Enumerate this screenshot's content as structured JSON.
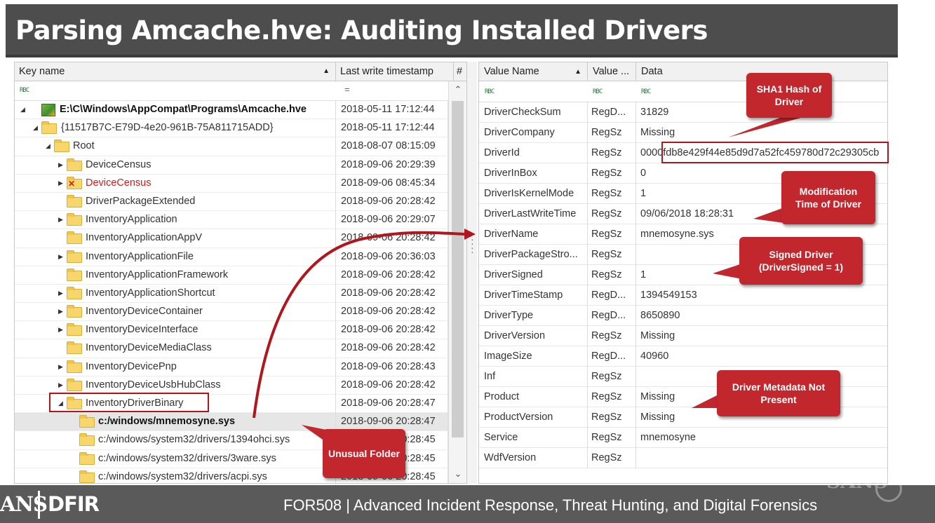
{
  "slide": {
    "title": "Parsing Amcache.hve: Auditing Installed Drivers",
    "footer_brand_left": "ANS",
    "footer_brand_right": "DFIR",
    "footer_course": "FOR508  |  Advanced Incident Response, Threat Hunting, and Digital Forensics",
    "watermark": "SANS"
  },
  "left_pane": {
    "columns": [
      "Key name",
      "Last write timestamp",
      "#"
    ],
    "filter_icon": "RBC",
    "eq_icon": "=",
    "rows": [
      {
        "label": "E:\\C\\Windows\\AppCompat\\Programs\\Amcache.hve",
        "ts": "2018-05-11 17:12:44"
      },
      {
        "label": "{11517B7C-E79D-4e20-961B-75A811715ADD}",
        "ts": "2018-05-11 17:12:44"
      },
      {
        "label": "Root",
        "ts": "2018-08-07 08:15:09"
      },
      {
        "label": "DeviceCensus",
        "ts": "2018-09-06 20:29:39"
      },
      {
        "label": "DeviceCensus",
        "ts": "2018-09-06 08:45:34"
      },
      {
        "label": "DriverPackageExtended",
        "ts": "2018-09-06 20:28:42"
      },
      {
        "label": "InventoryApplication",
        "ts": "2018-09-06 20:29:07"
      },
      {
        "label": "InventoryApplicationAppV",
        "ts": "2018-09-06 20:28:42"
      },
      {
        "label": "InventoryApplicationFile",
        "ts": "2018-09-06 20:36:03"
      },
      {
        "label": "InventoryApplicationFramework",
        "ts": "2018-09-06 20:28:42"
      },
      {
        "label": "InventoryApplicationShortcut",
        "ts": "2018-09-06 20:28:42"
      },
      {
        "label": "InventoryDeviceContainer",
        "ts": "2018-09-06 20:28:42"
      },
      {
        "label": "InventoryDeviceInterface",
        "ts": "2018-09-06 20:28:42"
      },
      {
        "label": "InventoryDeviceMediaClass",
        "ts": "2018-09-06 20:28:42"
      },
      {
        "label": "InventoryDevicePnp",
        "ts": "2018-09-06 20:28:43"
      },
      {
        "label": "InventoryDeviceUsbHubClass",
        "ts": "2018-09-06 20:28:42"
      },
      {
        "label": "InventoryDriverBinary",
        "ts": "2018-09-06 20:28:47"
      },
      {
        "label": "c:/windows/mnemosyne.sys",
        "ts": "2018-09-06 20:28:47"
      },
      {
        "label": "c:/windows/system32/drivers/1394ohci.sys",
        "ts": "2018-09-06 20:28:45"
      },
      {
        "label": "c:/windows/system32/drivers/3ware.sys",
        "ts": "2018-09-06 20:28:45"
      },
      {
        "label": "c:/windows/system32/drivers/acpi.sys",
        "ts": "2018-09-06 20:28:45"
      }
    ]
  },
  "right_pane": {
    "columns": [
      "Value Name",
      "Value ...",
      "Data"
    ],
    "filter_icon": "RBC",
    "rows": [
      {
        "name": "DriverCheckSum",
        "type": "RegD...",
        "data": "31829"
      },
      {
        "name": "DriverCompany",
        "type": "RegSz",
        "data": "Missing"
      },
      {
        "name": "DriverId",
        "type": "RegSz",
        "data": "0000fdb8e429f44e85d9d7a52fc459780d72c29305cb"
      },
      {
        "name": "DriverInBox",
        "type": "RegSz",
        "data": "0"
      },
      {
        "name": "DriverIsKernelMode",
        "type": "RegSz",
        "data": "1"
      },
      {
        "name": "DriverLastWriteTime",
        "type": "RegSz",
        "data": "09/06/2018 18:28:31"
      },
      {
        "name": "DriverName",
        "type": "RegSz",
        "data": "mnemosyne.sys"
      },
      {
        "name": "DriverPackageStro...",
        "type": "RegSz",
        "data": ""
      },
      {
        "name": "DriverSigned",
        "type": "RegSz",
        "data": "1"
      },
      {
        "name": "DriverTimeStamp",
        "type": "RegD...",
        "data": "1394549153"
      },
      {
        "name": "DriverType",
        "type": "RegD...",
        "data": "8650890"
      },
      {
        "name": "DriverVersion",
        "type": "RegSz",
        "data": "Missing"
      },
      {
        "name": "ImageSize",
        "type": "RegD...",
        "data": "40960"
      },
      {
        "name": "Inf",
        "type": "RegSz",
        "data": ""
      },
      {
        "name": "Product",
        "type": "RegSz",
        "data": "Missing"
      },
      {
        "name": "ProductVersion",
        "type": "RegSz",
        "data": "Missing"
      },
      {
        "name": "Service",
        "type": "RegSz",
        "data": "mnemosyne"
      },
      {
        "name": "WdfVersion",
        "type": "RegSz",
        "data": ""
      }
    ]
  },
  "callouts": {
    "sha1": "SHA1 Hash of Driver",
    "modtime": "Modification Time of Driver",
    "signed": "Signed Driver (DriverSigned = 1)",
    "metadata": "Driver Metadata Not Present",
    "unusual": "Unusual Folder"
  },
  "colors": {
    "callout": "#c1272d",
    "title_bar": "#4d4d4d",
    "footer": "#5a5a5a",
    "deleted_key": "#d21a1a"
  }
}
